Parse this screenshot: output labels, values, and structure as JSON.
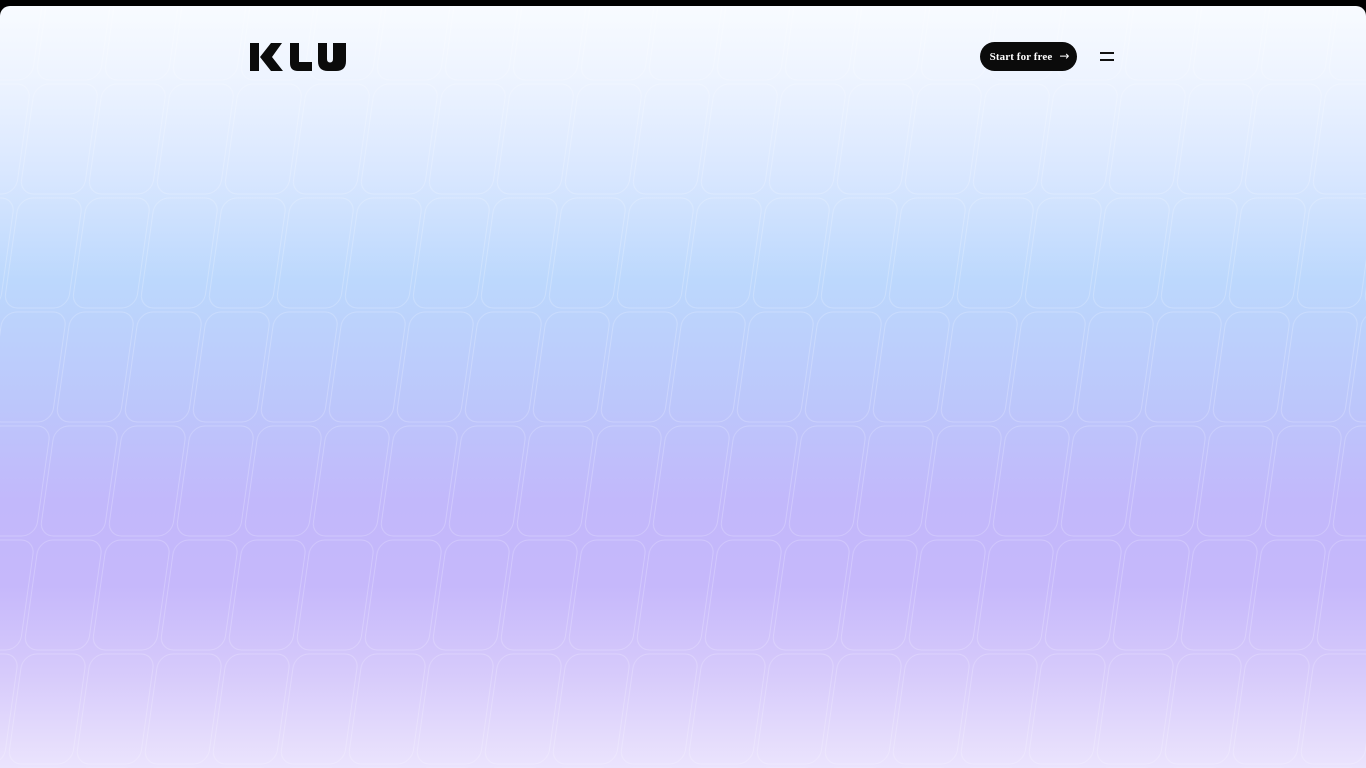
{
  "brand": {
    "name": "KLU",
    "color": "#0b0b0b"
  },
  "header": {
    "cta_label": "Start for free",
    "cta_arrow": "→",
    "menu_icon": "hamburger-menu-icon"
  },
  "theme": {
    "gradient_top": "#f8fbff",
    "gradient_mid_blue": "#bcd8fd",
    "gradient_mid_purple": "#c6b8fb",
    "gradient_bottom": "#ebe4fd"
  }
}
